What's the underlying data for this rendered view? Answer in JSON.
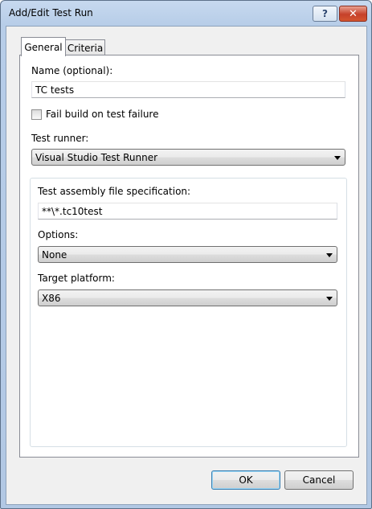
{
  "window": {
    "title": "Add/Edit Test Run",
    "help_label": "?",
    "close_label": "✕"
  },
  "tabs": [
    {
      "label": "General",
      "selected": true
    },
    {
      "label": "Criteria",
      "selected": false
    }
  ],
  "general": {
    "name_label": "Name (optional):",
    "name_value": "TC tests",
    "fail_build_label": "Fail build on test failure",
    "fail_build_checked": false,
    "test_runner_label": "Test runner:",
    "test_runner_value": "Visual Studio Test Runner",
    "assembly_label": "Test assembly file specification:",
    "assembly_value": "**\\*.tc10test",
    "options_label": "Options:",
    "options_value": "None",
    "platform_label": "Target platform:",
    "platform_value": "X86"
  },
  "buttons": {
    "ok_label": "OK",
    "cancel_label": "Cancel"
  },
  "icons": {
    "help": "help-icon",
    "close": "close-icon",
    "dropdown": "chevron-down-icon"
  }
}
